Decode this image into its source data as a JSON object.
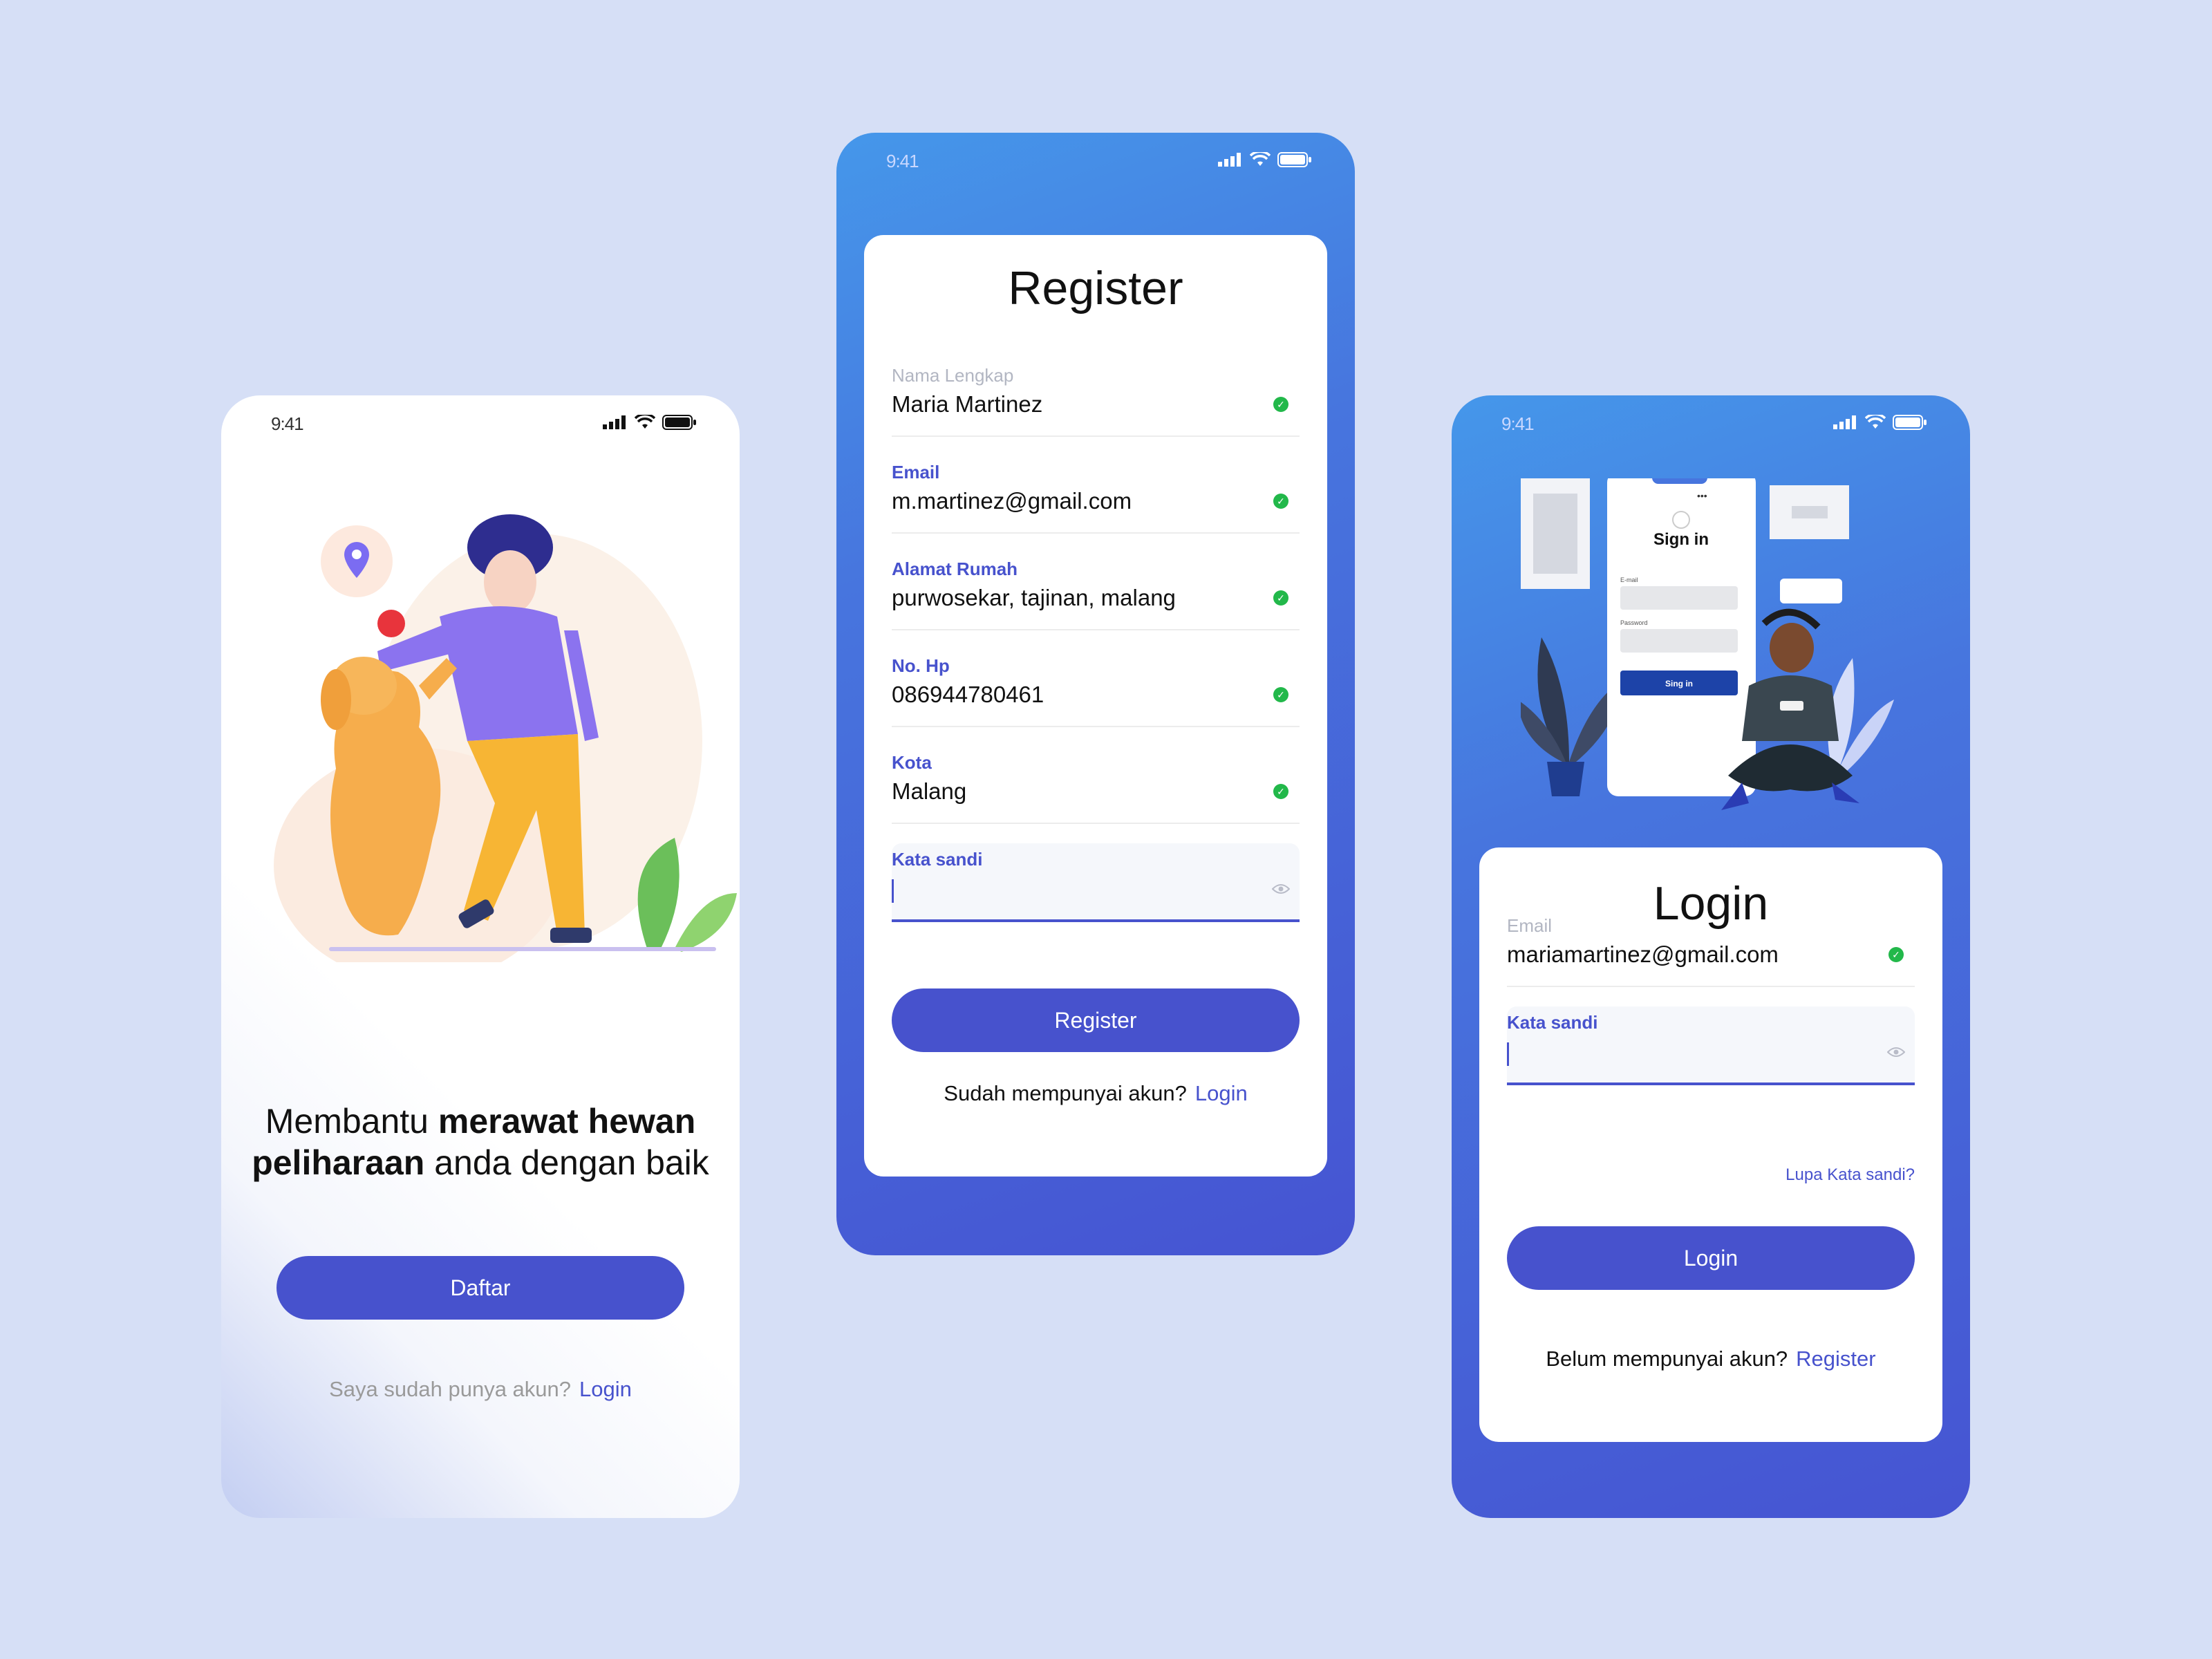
{
  "status_time": "9:41",
  "splash": {
    "headline_pre": "Membantu ",
    "headline_bold1": "merawat hewan peliharaan",
    "headline_mid": " anda dengan baik",
    "primary_button": "Daftar",
    "footer_text": "Saya sudah punya akun?",
    "footer_link": "Login"
  },
  "register": {
    "title": "Register",
    "fields": [
      {
        "label": "Nama Lengkap",
        "value": "Maria Martinez"
      },
      {
        "label": "Email",
        "value": "m.martinez@gmail.com"
      },
      {
        "label": "Alamat Rumah",
        "value": "purwosekar, tajinan, malang"
      },
      {
        "label": "No. Hp",
        "value": "086944780461"
      },
      {
        "label": "Kota",
        "value": "Malang"
      }
    ],
    "password_label": "Kata sandi",
    "button": "Register",
    "footer_text": "Sudah mempunyai akun?",
    "footer_link": "Login"
  },
  "login": {
    "mock_title": "Sign in",
    "mock_email": "E-mail",
    "mock_password": "Password",
    "mock_button": "Sing in",
    "title": "Login",
    "email_label": "Email",
    "email_value": "mariamartinez@gmail.com",
    "password_label": "Kata sandi",
    "forgot": "Lupa Kata sandi?",
    "button": "Login",
    "footer_text": "Belum mempunyai akun?",
    "footer_link": "Register"
  },
  "colors": {
    "accent": "#4752cd",
    "success": "#22b84a",
    "background": "#d6dff6"
  }
}
